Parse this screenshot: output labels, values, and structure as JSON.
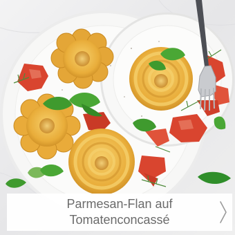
{
  "recipe_card": {
    "title_line_1": "Parmesan-Flan auf",
    "title_line_2": "Tomatenconcassé",
    "next_icon": "chevron-right-icon"
  },
  "colors": {
    "background_marble": "#e9e9ea",
    "plate": "#f7f7f6",
    "flan": "#e9ad3a",
    "tomato": "#d9452f",
    "basil": "#3f9a2e",
    "caption_text": "#6b6b6b"
  }
}
